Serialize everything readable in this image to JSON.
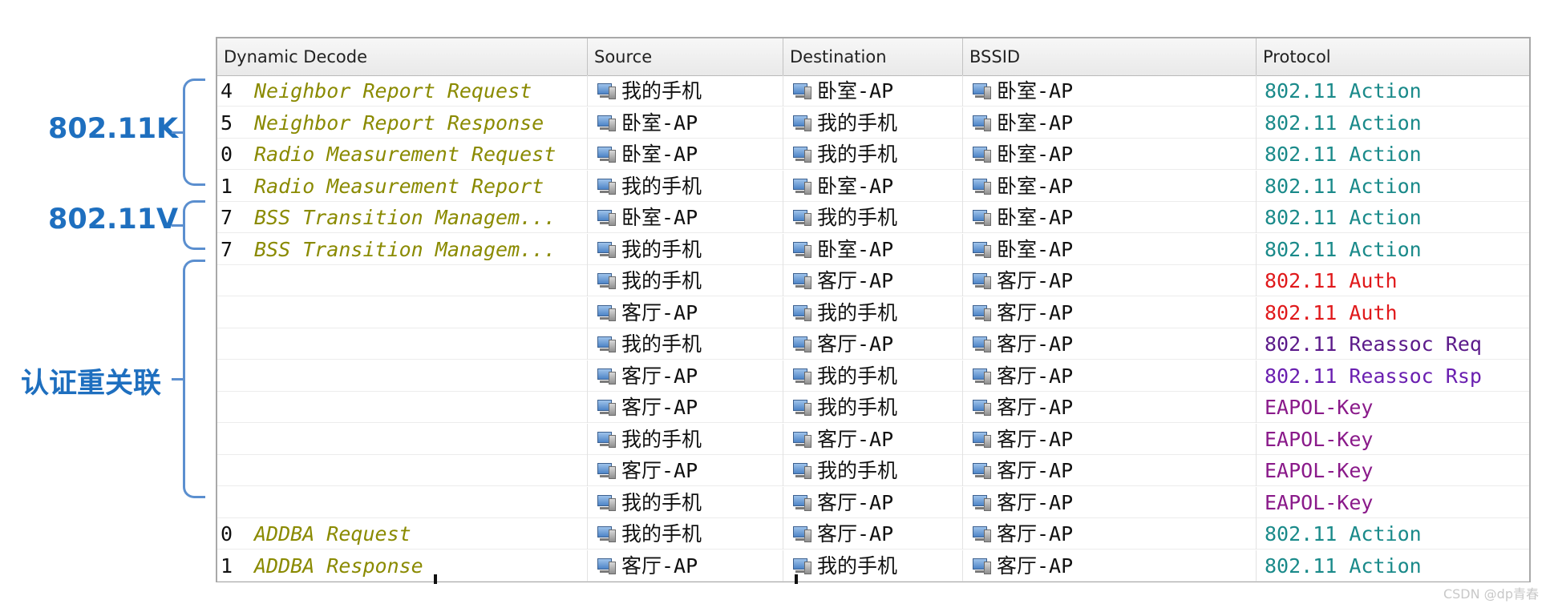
{
  "annotations": [
    {
      "label": "802.11K"
    },
    {
      "label": "802.11V"
    },
    {
      "label": "认证重关联"
    }
  ],
  "table": {
    "headers": {
      "decode": "Dynamic Decode",
      "source": "Source",
      "destination": "Destination",
      "bssid": "BSSID",
      "protocol": "Protocol"
    },
    "rows": [
      {
        "seq": "4",
        "decode": "Neighbor Report Request",
        "source": "我的手机",
        "destination": "卧室-AP",
        "bssid": "卧室-AP",
        "protocol": "802.11 Action",
        "protocol_color": "#1a8a8a"
      },
      {
        "seq": "5",
        "decode": "Neighbor Report Response",
        "source": "卧室-AP",
        "destination": "我的手机",
        "bssid": "卧室-AP",
        "protocol": "802.11 Action",
        "protocol_color": "#1a8a8a"
      },
      {
        "seq": "0",
        "decode": "Radio Measurement Request",
        "source": "卧室-AP",
        "destination": "我的手机",
        "bssid": "卧室-AP",
        "protocol": "802.11 Action",
        "protocol_color": "#1a8a8a"
      },
      {
        "seq": "1",
        "decode": "Radio Measurement Report",
        "source": "我的手机",
        "destination": "卧室-AP",
        "bssid": "卧室-AP",
        "protocol": "802.11 Action",
        "protocol_color": "#1a8a8a"
      },
      {
        "seq": "7",
        "decode": "BSS Transition Managem...",
        "source": "卧室-AP",
        "destination": "我的手机",
        "bssid": "卧室-AP",
        "protocol": "802.11 Action",
        "protocol_color": "#1a8a8a"
      },
      {
        "seq": "7",
        "decode": "BSS Transition Managem...",
        "source": "我的手机",
        "destination": "卧室-AP",
        "bssid": "卧室-AP",
        "protocol": "802.11 Action",
        "protocol_color": "#1a8a8a"
      },
      {
        "seq": "",
        "decode": "",
        "source": "我的手机",
        "destination": "客厅-AP",
        "bssid": "客厅-AP",
        "protocol": "802.11 Auth",
        "protocol_color": "#e0191b"
      },
      {
        "seq": "",
        "decode": "",
        "source": "客厅-AP",
        "destination": "我的手机",
        "bssid": "客厅-AP",
        "protocol": "802.11 Auth",
        "protocol_color": "#e0191b"
      },
      {
        "seq": "",
        "decode": "",
        "source": "我的手机",
        "destination": "客厅-AP",
        "bssid": "客厅-AP",
        "protocol": "802.11 Reassoc Req",
        "protocol_color": "#5b1a8a"
      },
      {
        "seq": "",
        "decode": "",
        "source": "客厅-AP",
        "destination": "我的手机",
        "bssid": "客厅-AP",
        "protocol": "802.11 Reassoc Rsp",
        "protocol_color": "#6a1fb0"
      },
      {
        "seq": "",
        "decode": "",
        "source": "客厅-AP",
        "destination": "我的手机",
        "bssid": "客厅-AP",
        "protocol": "EAPOL-Key",
        "protocol_color": "#8a1a8a"
      },
      {
        "seq": "",
        "decode": "",
        "source": "我的手机",
        "destination": "客厅-AP",
        "bssid": "客厅-AP",
        "protocol": "EAPOL-Key",
        "protocol_color": "#8a1a8a"
      },
      {
        "seq": "",
        "decode": "",
        "source": "客厅-AP",
        "destination": "我的手机",
        "bssid": "客厅-AP",
        "protocol": "EAPOL-Key",
        "protocol_color": "#8a1a8a"
      },
      {
        "seq": "",
        "decode": "",
        "source": "我的手机",
        "destination": "客厅-AP",
        "bssid": "客厅-AP",
        "protocol": "EAPOL-Key",
        "protocol_color": "#8a1a8a"
      },
      {
        "seq": "0",
        "decode": "ADDBA Request",
        "source": "我的手机",
        "destination": "客厅-AP",
        "bssid": "客厅-AP",
        "protocol": "802.11 Action",
        "protocol_color": "#1a8a8a"
      },
      {
        "seq": "1",
        "decode": "ADDBA Response",
        "source": "客厅-AP",
        "destination": "我的手机",
        "bssid": "客厅-AP",
        "protocol": "802.11 Action",
        "protocol_color": "#1a8a8a"
      }
    ]
  },
  "watermark": "CSDN @dp青春"
}
